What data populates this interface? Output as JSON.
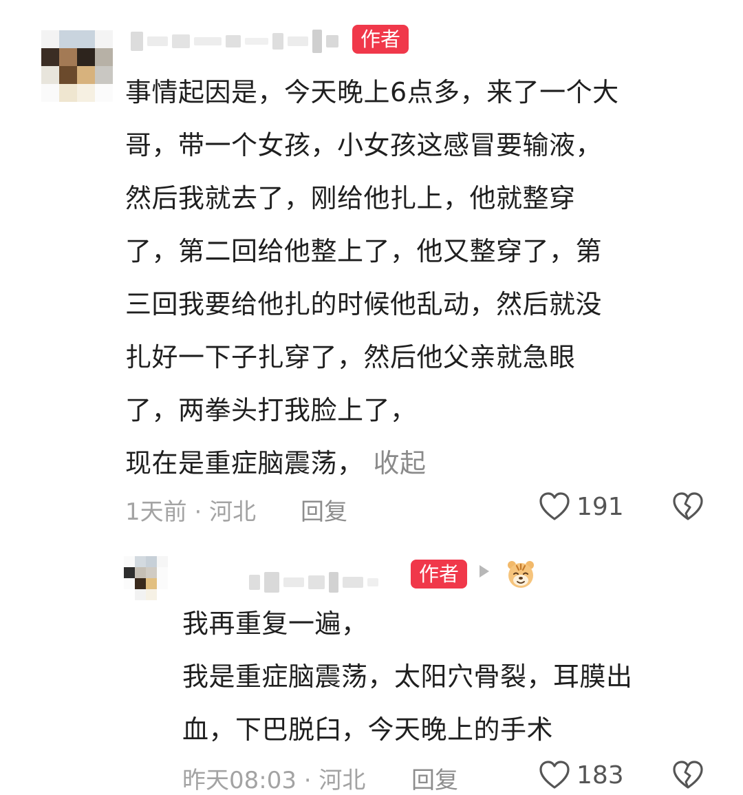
{
  "comment": {
    "author_badge": "作者",
    "text_lines": [
      "事情起因是，今天晚上6点多，来了一个大",
      "哥，带一个女孩，小女孩这感冒要输液，",
      "然后我就去了，刚给他扎上，他就整穿",
      "了，第二回给他整上了，他又整穿了，第",
      "三回我要给他扎的时候他乱动，然后就没",
      "扎好一下子扎穿了，然后他父亲就急眼",
      "了，两拳头打我脸上了，",
      "现在是重症脑震荡，"
    ],
    "collapse_label": "收起",
    "time": "1天前",
    "location": "河北",
    "reply_label": "回复",
    "likes": "191",
    "avatar_icon": "pixelated-avatar",
    "like_icon": "heart-outline-icon",
    "dislike_icon": "broken-heart-icon"
  },
  "reply_comment": {
    "author_badge": "作者",
    "text_lines": [
      "我再重复一遍，",
      "我是重症脑震荡，太阳穴骨裂，耳膜出",
      "血，下巴脱臼，今天晚上的手术"
    ],
    "time": "昨天08:03",
    "location": "河北",
    "reply_label": "回复",
    "likes": "183",
    "emoji_icon": "tiger-face-icon",
    "arrow_icon": "reply-arrow-icon"
  },
  "colors": {
    "badge": "#f0384a",
    "meta_text": "#a3a3a3",
    "body_text": "#1f1f1f"
  }
}
